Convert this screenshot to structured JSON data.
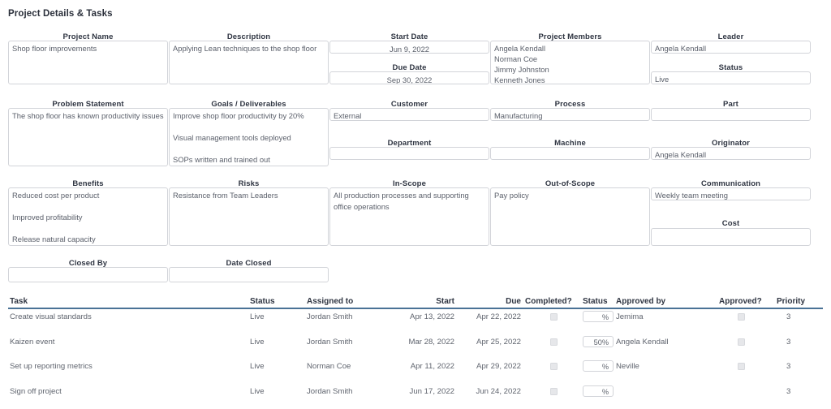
{
  "page_title": "Project Details & Tasks",
  "accent_color": "#4a7296",
  "sections": {
    "row1": {
      "project_name": {
        "label": "Project Name",
        "value": "Shop floor improvements"
      },
      "description": {
        "label": "Description",
        "value": "Applying Lean techniques to the shop floor"
      },
      "start_date": {
        "label": "Start Date",
        "value": "Jun 9, 2022"
      },
      "due_date": {
        "label": "Due Date",
        "value": "Sep 30, 2022"
      },
      "project_members": {
        "label": "Project Members",
        "value": "Angela Kendall\nNorman Coe\nJimmy Johnston\nKenneth Jones"
      },
      "leader": {
        "label": "Leader",
        "value": "Angela Kendall"
      },
      "status": {
        "label": "Status",
        "value": "Live"
      }
    },
    "row2": {
      "problem_statement": {
        "label": "Problem Statement",
        "value": "The shop floor has known productivity issues"
      },
      "goals": {
        "label": "Goals / Deliverables",
        "value": "Improve shop floor productivity by 20%\n\nVisual management tools deployed\n\nSOPs written and trained out"
      },
      "customer": {
        "label": "Customer",
        "value": "External"
      },
      "process": {
        "label": "Process",
        "value": "Manufacturing"
      },
      "part": {
        "label": "Part",
        "value": ""
      },
      "department": {
        "label": "Department",
        "value": ""
      },
      "machine": {
        "label": "Machine",
        "value": ""
      },
      "originator": {
        "label": "Originator",
        "value": "Angela Kendall"
      }
    },
    "row3": {
      "benefits": {
        "label": "Benefits",
        "value": "Reduced cost per product\n\nImproved profitability\n\nRelease natural capacity"
      },
      "risks": {
        "label": "Risks",
        "value": "Resistance from Team Leaders"
      },
      "in_scope": {
        "label": "In-Scope",
        "value": "All production processes and supporting office operations"
      },
      "out_of_scope": {
        "label": "Out-of-Scope",
        "value": "Pay policy"
      },
      "communication": {
        "label": "Communication",
        "value": "Weekly team meeting"
      },
      "cost": {
        "label": "Cost",
        "value": ""
      }
    },
    "row4": {
      "closed_by": {
        "label": "Closed By",
        "value": ""
      },
      "date_closed": {
        "label": "Date Closed",
        "value": ""
      }
    }
  },
  "task_table": {
    "columns": {
      "task": "Task",
      "status": "Status",
      "assigned_to": "Assigned to",
      "start": "Start",
      "due": "Due",
      "completed": "Completed?",
      "progress_status": "Status",
      "approved_by": "Approved by",
      "approved": "Approved?",
      "priority": "Priority"
    },
    "rows": [
      {
        "task": "Create visual standards",
        "status": "Live",
        "assigned_to": "Jordan Smith",
        "start": "Apr 13, 2022",
        "due": "Apr 22, 2022",
        "completed": false,
        "progress": "%",
        "approved_by": "Jemima",
        "has_approved_checkbox": true,
        "approved": false,
        "priority": "3"
      },
      {
        "task": "Kaizen event",
        "status": "Live",
        "assigned_to": "Jordan Smith",
        "start": "Mar 28, 2022",
        "due": "Apr 25, 2022",
        "completed": false,
        "progress": "50%",
        "approved_by": "Angela Kendall",
        "has_approved_checkbox": true,
        "approved": false,
        "priority": "3"
      },
      {
        "task": "Set up reporting metrics",
        "status": "Live",
        "assigned_to": "Norman Coe",
        "start": "Apr 11, 2022",
        "due": "Apr 29, 2022",
        "completed": false,
        "progress": "%",
        "approved_by": "Neville",
        "has_approved_checkbox": true,
        "approved": false,
        "priority": "3"
      },
      {
        "task": "Sign off project",
        "status": "Live",
        "assigned_to": "Jordan Smith",
        "start": "Jun 17, 2022",
        "due": "Jun 24, 2022",
        "completed": false,
        "progress": "%",
        "approved_by": "",
        "has_approved_checkbox": false,
        "approved": false,
        "priority": "3"
      }
    ]
  }
}
